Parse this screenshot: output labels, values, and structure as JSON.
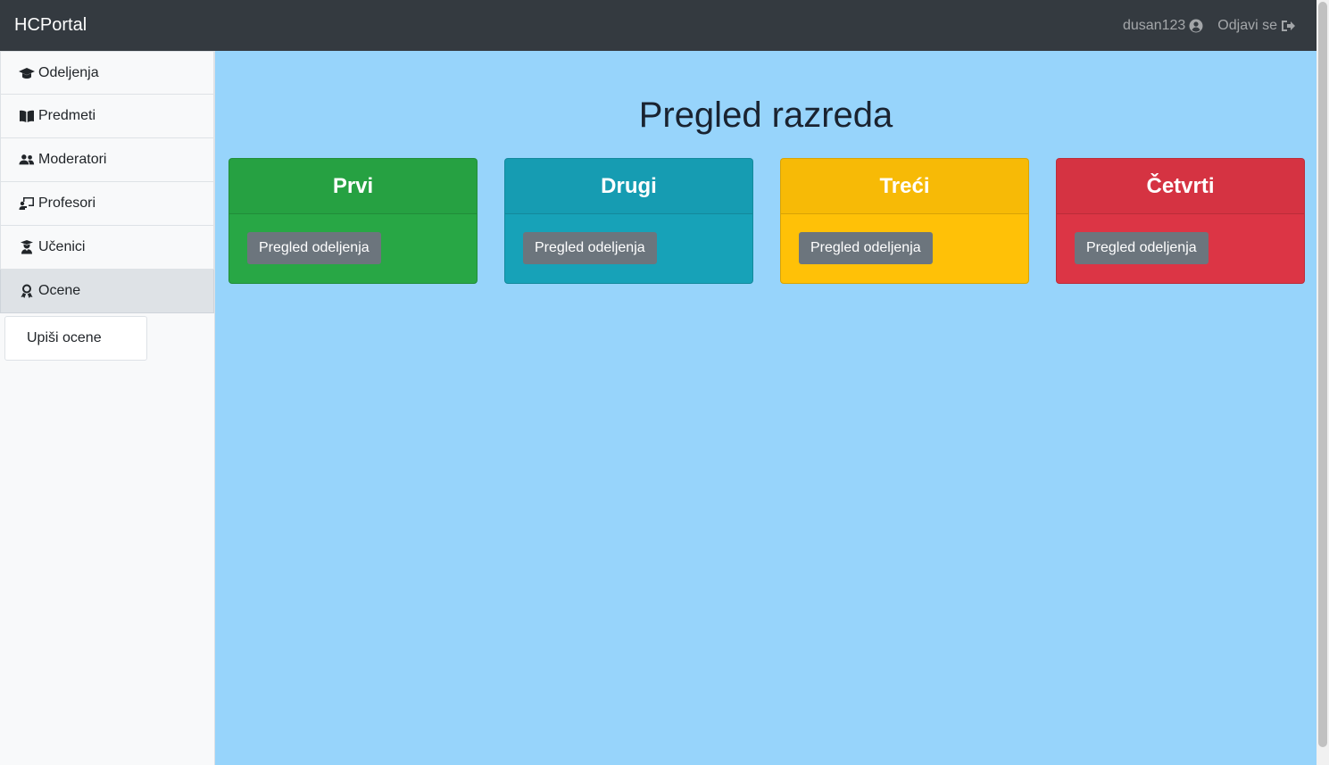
{
  "navbar": {
    "brand": "HCPortal",
    "user": "dusan123",
    "logout": "Odjavi se"
  },
  "sidebar": {
    "items": [
      {
        "label": "Odeljenja",
        "icon": "graduation-cap-icon"
      },
      {
        "label": "Predmeti",
        "icon": "book-icon"
      },
      {
        "label": "Moderatori",
        "icon": "users-icon"
      },
      {
        "label": "Profesori",
        "icon": "chalkboard-teacher-icon"
      },
      {
        "label": "Učenici",
        "icon": "user-graduate-icon"
      },
      {
        "label": "Ocene",
        "icon": "award-icon"
      }
    ],
    "sub_item": "Upiši ocene"
  },
  "main": {
    "title": "Pregled razreda",
    "cards": [
      {
        "title": "Prvi",
        "button": "Pregled odeljenja",
        "color": "#28a745"
      },
      {
        "title": "Drugi",
        "button": "Pregled odeljenja",
        "color": "#17a2b8"
      },
      {
        "title": "Treći",
        "button": "Pregled odeljenja",
        "color": "#ffc107"
      },
      {
        "title": "Četvrti",
        "button": "Pregled odeljenja",
        "color": "#dc3545"
      }
    ]
  }
}
